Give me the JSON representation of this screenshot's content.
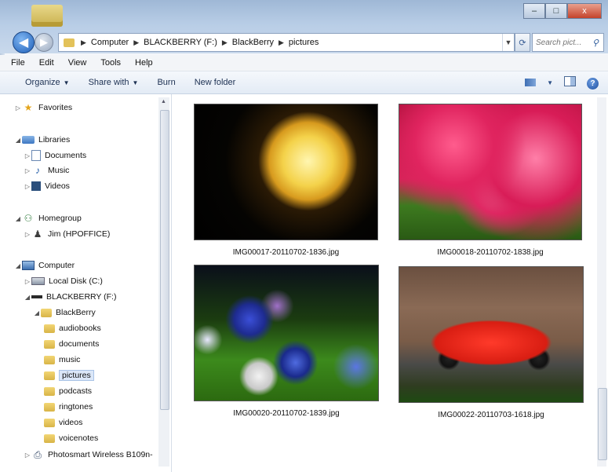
{
  "window": {
    "controls": {
      "minimize": "–",
      "maximize": "□",
      "close": "x"
    }
  },
  "address_bar": {
    "back_icon": "back-arrow-icon",
    "forward_icon": "forward-arrow-icon",
    "crumbs": [
      "Computer",
      "BLACKBERRY (F:)",
      "BlackBerry",
      "pictures"
    ],
    "search_placeholder": "Search pict..."
  },
  "menubar": {
    "items": [
      "File",
      "Edit",
      "View",
      "Tools",
      "Help"
    ]
  },
  "commandbar": {
    "organize": "Organize",
    "share_with": "Share with",
    "burn": "Burn",
    "new_folder": "New folder"
  },
  "navpane": {
    "favorites": "Favorites",
    "libraries": "Libraries",
    "documents": "Documents",
    "music": "Music",
    "videos": "Videos",
    "homegroup": "Homegroup",
    "user": "Jim (HPOFFICE)",
    "computer": "Computer",
    "local_disk": "Local Disk (C:)",
    "blackberry_drive": "BLACKBERRY (F:)",
    "blackberry_folder": "BlackBerry",
    "subfolders": [
      "audiobooks",
      "documents",
      "music",
      "pictures",
      "podcasts",
      "ringtones",
      "videos",
      "voicenotes"
    ],
    "printer": "Photosmart Wireless B109n-"
  },
  "content": {
    "files": [
      {
        "name": "IMG00017-20110702-1836.jpg"
      },
      {
        "name": "IMG00018-20110702-1838.jpg"
      },
      {
        "name": "IMG00020-20110702-1839.jpg"
      },
      {
        "name": "IMG00022-20110703-1618.jpg"
      }
    ]
  },
  "colors": {
    "accent": "#1f5fb8",
    "selection": "#dbe7f8"
  }
}
